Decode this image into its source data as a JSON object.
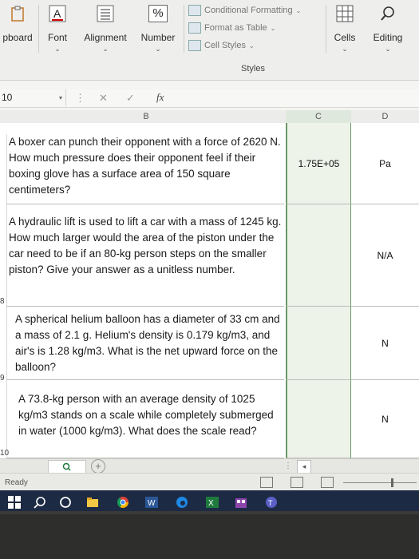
{
  "ribbon": {
    "groups": [
      {
        "label": "pboard"
      },
      {
        "label": "Font"
      },
      {
        "label": "Alignment"
      },
      {
        "label": "Number"
      },
      {
        "label": "Cells"
      },
      {
        "label": "Editing"
      }
    ],
    "styles": {
      "items": [
        "Conditional Formatting",
        "Format as Table",
        "Cell Styles"
      ],
      "label": "Styles"
    },
    "number_icon": "%"
  },
  "formula_bar": {
    "name_box": "10",
    "fx": "fx"
  },
  "columns": {
    "b": "B",
    "c": "C",
    "d": "D"
  },
  "rows": [
    {
      "header": "",
      "question": "A boxer can punch their opponent with a force of 2620 N. How much pressure does their opponent feel if their boxing glove has a surface area of 150 square centimeters?",
      "answer": "1.75E+05",
      "unit": "Pa"
    },
    {
      "header": "8",
      "question": "A hydraulic lift is used to lift a car with a mass of 1245 kg. How much larger would the area of the piston under the car need to be if an 80-kg person steps on the smaller piston? Give your answer as a unitless number.",
      "answer": "",
      "unit": "N/A"
    },
    {
      "header": "9",
      "question": "A spherical helium balloon has a diameter of 33 cm and a mass of 2.1 g. Helium's density is 0.179 kg/m3, and air's is 1.28 kg/m3. What is the net upward force on the balloon?",
      "answer": "",
      "unit": "N"
    },
    {
      "header": "10",
      "question": "A 73.8-kg person with an average density of 1025 kg/m3 stands on a scale while completely submerged in water (1000 kg/m3). What does the scale read?",
      "answer": "",
      "unit": "N"
    }
  ],
  "tab_strip": {
    "add": "+"
  },
  "status": {
    "text": "Ready"
  },
  "colors": {
    "selected_border": "#6a9a66",
    "taskbar": "#1d2a44",
    "excel_green": "#1f7a3d"
  }
}
